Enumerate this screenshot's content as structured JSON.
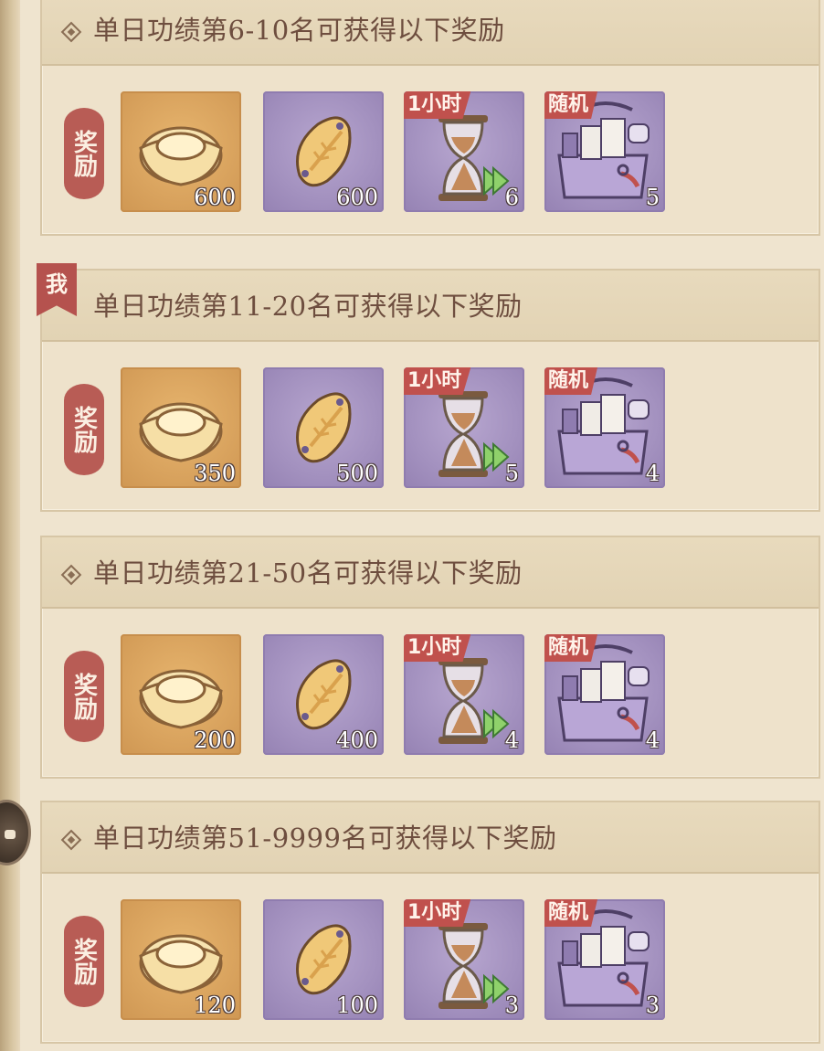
{
  "badge_me": "我",
  "reward_tag": "奖励",
  "cards": [
    {
      "title": "单日功绩第6-10名可获得以下奖励",
      "is_mine": false,
      "items": [
        {
          "icon": "gold-ingot-icon",
          "qty": "600"
        },
        {
          "icon": "seed-token-icon",
          "qty": "600"
        },
        {
          "icon": "hourglass-speedup-icon",
          "ribbon": "1小时",
          "qty": "6"
        },
        {
          "icon": "random-chest-icon",
          "ribbon": "随机",
          "qty": "5"
        }
      ]
    },
    {
      "title": "单日功绩第11-20名可获得以下奖励",
      "is_mine": true,
      "items": [
        {
          "icon": "gold-ingot-icon",
          "qty": "350"
        },
        {
          "icon": "seed-token-icon",
          "qty": "500"
        },
        {
          "icon": "hourglass-speedup-icon",
          "ribbon": "1小时",
          "qty": "5"
        },
        {
          "icon": "random-chest-icon",
          "ribbon": "随机",
          "qty": "4"
        }
      ]
    },
    {
      "title": "单日功绩第21-50名可获得以下奖励",
      "is_mine": false,
      "items": [
        {
          "icon": "gold-ingot-icon",
          "qty": "200"
        },
        {
          "icon": "seed-token-icon",
          "qty": "400"
        },
        {
          "icon": "hourglass-speedup-icon",
          "ribbon": "1小时",
          "qty": "4"
        },
        {
          "icon": "random-chest-icon",
          "ribbon": "随机",
          "qty": "4"
        }
      ]
    },
    {
      "title": "单日功绩第51-9999名可获得以下奖励",
      "is_mine": false,
      "items": [
        {
          "icon": "gold-ingot-icon",
          "qty": "120"
        },
        {
          "icon": "seed-token-icon",
          "qty": "100"
        },
        {
          "icon": "hourglass-speedup-icon",
          "ribbon": "1小时",
          "qty": "3"
        },
        {
          "icon": "random-chest-icon",
          "ribbon": "随机",
          "qty": "3"
        }
      ]
    }
  ]
}
